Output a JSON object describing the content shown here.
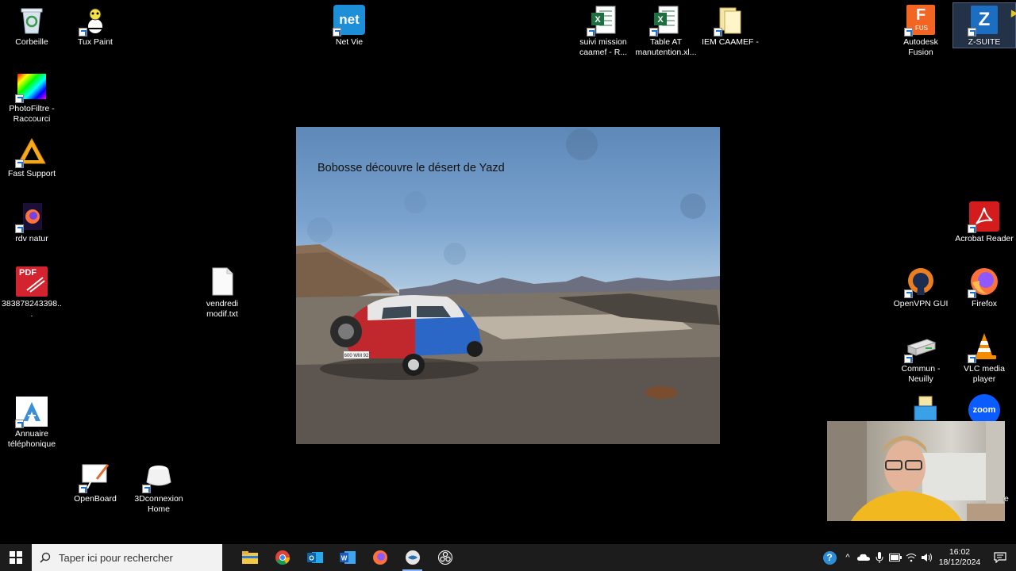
{
  "desktop": {
    "icons": {
      "corbeille": "Corbeille",
      "tuxpaint": "Tux Paint",
      "netvie": "Net Vie",
      "suivi": "suivi mission caamef - R...",
      "tableat": "Table AT manutention.xl...",
      "iem": "IEM CAAMEF -",
      "fusion": "Autodesk Fusion",
      "zsuite": "Z-SUITE",
      "photofiltre": "PhotoFiltre - Raccourci",
      "fastsupport": "Fast Support",
      "rdvnatur": "rdv natur",
      "pdf": "383878243398...",
      "vendredi": "vendredi modif.txt",
      "acrobat": "Acrobat Reader",
      "openvpn": "OpenVPN GUI",
      "firefox": "Firefox",
      "commun": "Commun - Neuilly",
      "vlc": "VLC media player",
      "annuaire": "Annuaire téléphonique",
      "openboard": "OpenBoard",
      "connexion": "3Dconnexion Home",
      "zoom_badge": "zoom",
      "pdf_badge": "PDF",
      "net_badge": "net",
      "fusion_badge": "F",
      "fusion_sub": "FUS",
      "z_badge": "Z",
      "partial_label": "e"
    }
  },
  "photo": {
    "title": "Bobosse découvre le désert de Yazd",
    "plate": "600 WM 92"
  },
  "taskbar": {
    "search_placeholder": "Taper ici pour rechercher",
    "clock_time": "16:02",
    "clock_date": "18/12/2024",
    "help_glyph": "?",
    "chevron_glyph": "^"
  },
  "colors": {
    "taskbar": "#1c1c1c",
    "desktop": "#000000",
    "accent": "#8ab4f8"
  }
}
